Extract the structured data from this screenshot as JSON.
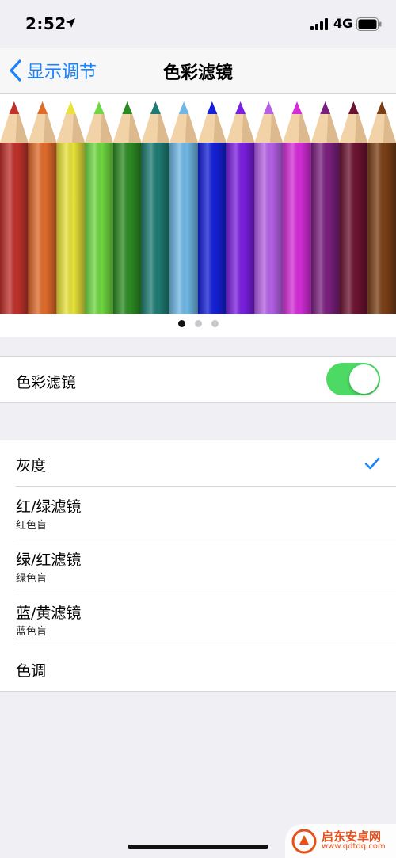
{
  "status_bar": {
    "time": "2:52",
    "network": "4G",
    "location_icon": "location-arrow-icon",
    "signal_icon": "cellular-signal-icon",
    "battery_icon": "battery-icon"
  },
  "nav": {
    "back_label": "显示调节",
    "title": "色彩滤镜"
  },
  "banner": {
    "pencil_colors": [
      "#c0312b",
      "#e06a2a",
      "#e8e23a",
      "#6ed640",
      "#2c8a22",
      "#1e7b74",
      "#6fb8e6",
      "#1420d8",
      "#7a1ee0",
      "#b560e6",
      "#d42cd8",
      "#7a1f7e",
      "#6b1230",
      "#7a3f16"
    ],
    "pages": 3,
    "active_page": 0
  },
  "toggle_row": {
    "label": "色彩滤镜",
    "enabled": true,
    "on_color": "#4cd964"
  },
  "filters": [
    {
      "title": "灰度",
      "subtitle": "",
      "selected": true
    },
    {
      "title": "红/绿滤镜",
      "subtitle": "红色盲",
      "selected": false
    },
    {
      "title": "绿/红滤镜",
      "subtitle": "绿色盲",
      "selected": false
    },
    {
      "title": "蓝/黄滤镜",
      "subtitle": "蓝色盲",
      "selected": false
    },
    {
      "title": "色调",
      "subtitle": "",
      "selected": false
    }
  ],
  "accent_color": "#1a82fb",
  "watermark": {
    "name": "启东安卓网",
    "url": "www.qdtdq.com"
  }
}
